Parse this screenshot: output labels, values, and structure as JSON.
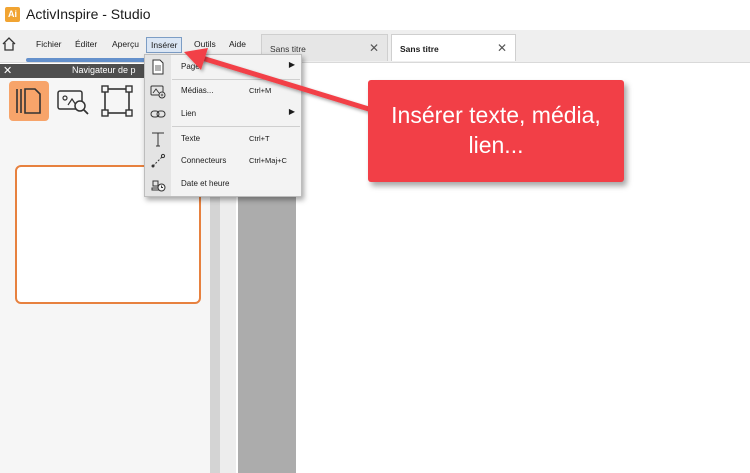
{
  "app": {
    "title": "ActivInspire - Studio",
    "logo_text": "Ai"
  },
  "menubar": {
    "items": [
      "Fichier",
      "Éditer",
      "Aperçu",
      "Insérer",
      "Outils",
      "Aide"
    ]
  },
  "tabs": [
    {
      "label": "Sans titre",
      "active": false,
      "close": "✕"
    },
    {
      "label": "Sans titre",
      "active": true,
      "close": "✕"
    }
  ],
  "navigator": {
    "title": "Navigateur de p",
    "close": "✕",
    "buttons": [
      "pages-icon",
      "search-page-icon",
      "select-frame-icon"
    ]
  },
  "insert_menu": {
    "items": [
      {
        "label": "Page",
        "shortcut": "",
        "submenu": "▶",
        "icon": "page-icon"
      },
      {
        "label": "Médias...",
        "shortcut": "Ctrl+M",
        "submenu": "",
        "icon": "media-icon"
      },
      {
        "label": "Lien",
        "shortcut": "",
        "submenu": "▶",
        "icon": "link-icon"
      },
      {
        "label": "Texte",
        "shortcut": "Ctrl+T",
        "submenu": "",
        "icon": "text-icon"
      },
      {
        "label": "Connecteurs",
        "shortcut": "Ctrl+Maj+C",
        "submenu": "",
        "icon": "connector-icon"
      },
      {
        "label": "Date et heure",
        "shortcut": "",
        "submenu": "",
        "icon": "date-time-icon"
      }
    ]
  },
  "callout": {
    "text": "Insérer texte, média, lien..."
  },
  "colors": {
    "accent": "#4b7fc4",
    "callout": "#f23f47",
    "nav_active": "#f7a46a",
    "thumb_border": "#e7813f"
  }
}
